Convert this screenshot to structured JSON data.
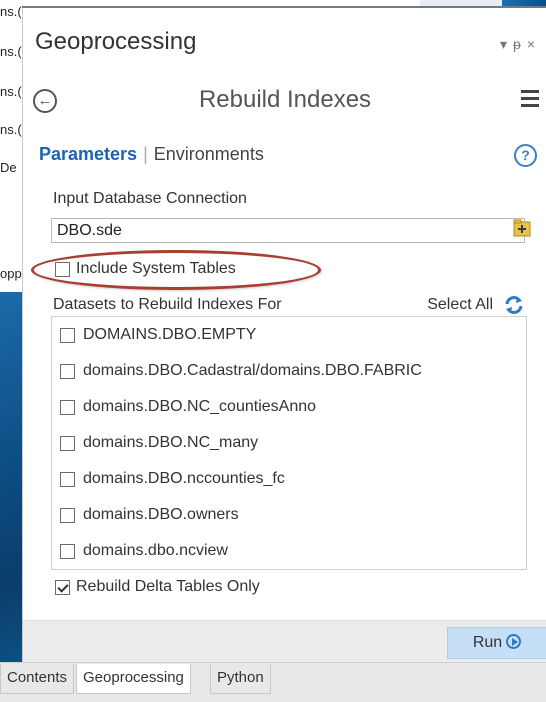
{
  "background_fragments": [
    "ns.(",
    "ns.(",
    "ns.(",
    "ns.(",
    "De",
    "opp"
  ],
  "pane": {
    "title": "Geoprocessing",
    "controls": [
      "▾",
      "ᵽ",
      "×"
    ]
  },
  "tool": {
    "title": "Rebuild Indexes",
    "back_icon": "back-arrow-icon",
    "menu_icon": "hamburger-menu-icon"
  },
  "tabs": {
    "parameters": "Parameters",
    "separator": "|",
    "environments": "Environments",
    "help_glyph": "?"
  },
  "params": {
    "input_db_label": "Input Database Connection",
    "input_db_value": "DBO.sde",
    "include_system_tables_label": "Include System Tables",
    "include_system_tables_checked": false,
    "datasets_label": "Datasets to Rebuild Indexes For",
    "select_all_label": "Select All",
    "datasets": [
      {
        "label": "DOMAINS.DBO.EMPTY",
        "checked": false
      },
      {
        "label": "domains.DBO.Cadastral/domains.DBO.FABRIC",
        "checked": false
      },
      {
        "label": "domains.DBO.NC_countiesAnno",
        "checked": false
      },
      {
        "label": "domains.DBO.NC_many",
        "checked": false
      },
      {
        "label": "domains.DBO.nccounties_fc",
        "checked": false
      },
      {
        "label": "domains.DBO.owners",
        "checked": false
      },
      {
        "label": "domains.dbo.ncview",
        "checked": false
      }
    ],
    "rebuild_delta_label": "Rebuild Delta Tables Only",
    "rebuild_delta_checked": true
  },
  "footer": {
    "run_label": "Run"
  },
  "bottom_tabs": [
    {
      "label": "Contents",
      "active": false
    },
    {
      "label": "Geoprocessing",
      "active": true
    },
    {
      "label": "Python",
      "active": false
    }
  ],
  "colors": {
    "accent_blue": "#1b64b4",
    "highlight_ring": "#a84032",
    "run_button": "#c5dff6"
  }
}
